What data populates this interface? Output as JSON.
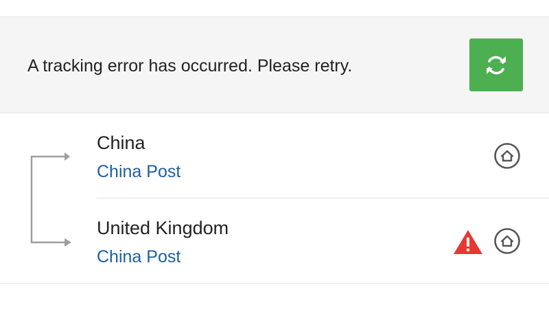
{
  "banner": {
    "message": "A tracking error has occurred. Please retry.",
    "retry_icon": "refresh-icon",
    "retry_color": "#4caf50"
  },
  "route": {
    "stops": [
      {
        "country": "China",
        "carrier": "China Post",
        "status_icon": "home-icon"
      },
      {
        "country": "United Kingdom",
        "carrier": "China Post",
        "warning_icon": "warning-icon",
        "warning_color": "#e53935",
        "status_icon": "home-icon"
      }
    ]
  }
}
